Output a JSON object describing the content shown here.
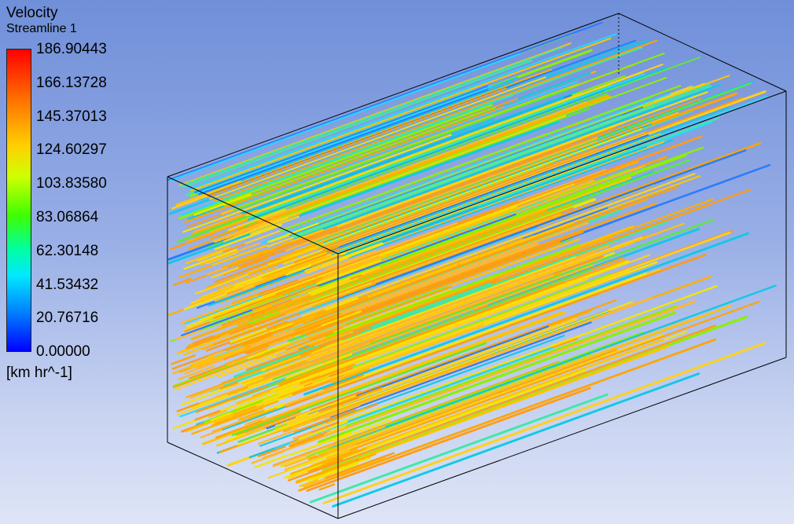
{
  "legend": {
    "title": "Velocity",
    "subtitle": "Streamline 1",
    "ticks": [
      "186.90443",
      "166.13728",
      "145.37013",
      "124.60297",
      "103.83580",
      "83.06864",
      "62.30148",
      "41.53432",
      "20.76716",
      "0.00000"
    ],
    "units": "[km hr^-1]",
    "colormap": [
      "#0000ff",
      "#0078ff",
      "#00e8ff",
      "#00ffa0",
      "#3eff00",
      "#cfff00",
      "#ffd000",
      "#ff7a00",
      "#ff0000"
    ]
  },
  "viewport": {
    "background_top": "#6f8fd9",
    "background_bottom": "#dfe5f7",
    "plot": "streamlines inside a 3D rectangular domain, predominantly orange/yellow with cyan/green lines"
  }
}
